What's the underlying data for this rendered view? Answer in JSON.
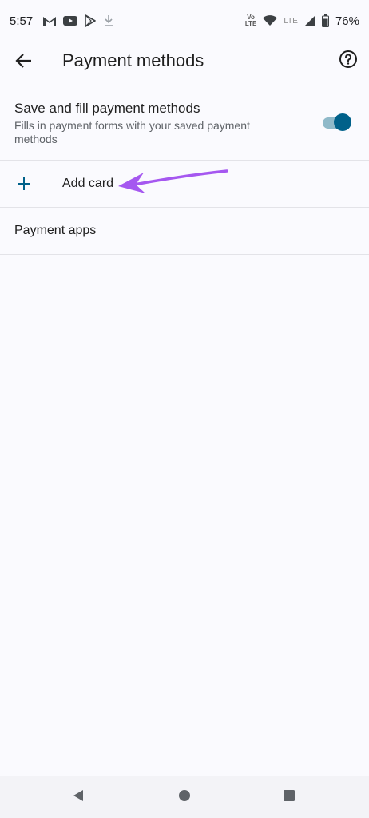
{
  "status_bar": {
    "time": "5:57",
    "volte_line1": "Vo",
    "volte_line2": "LTE",
    "lte": "LTE",
    "battery": "76%",
    "left_icons": [
      "gmail-icon",
      "youtube-icon",
      "play-store-icon",
      "download-icon"
    ],
    "right_icons": [
      "volte-icon",
      "wifi-icon",
      "signal-icon",
      "battery-icon"
    ]
  },
  "app_bar": {
    "title": "Payment methods",
    "back_icon": "arrow-left-icon",
    "help_icon": "help-circle-icon"
  },
  "settings": {
    "save_fill": {
      "title": "Save and fill payment methods",
      "description": "Fills in payment forms with your saved payment methods",
      "enabled": true
    },
    "add_card": {
      "label": "Add card",
      "icon": "plus-icon"
    },
    "payment_apps": {
      "label": "Payment apps"
    }
  },
  "colors": {
    "accent": "#00618a",
    "toggle_track": "#8fb9c9",
    "annotation_arrow": "#a557f0",
    "background": "#fafafe"
  },
  "nav_bar": {
    "icons": [
      "back-triangle-icon",
      "home-circle-icon",
      "recents-square-icon"
    ]
  }
}
